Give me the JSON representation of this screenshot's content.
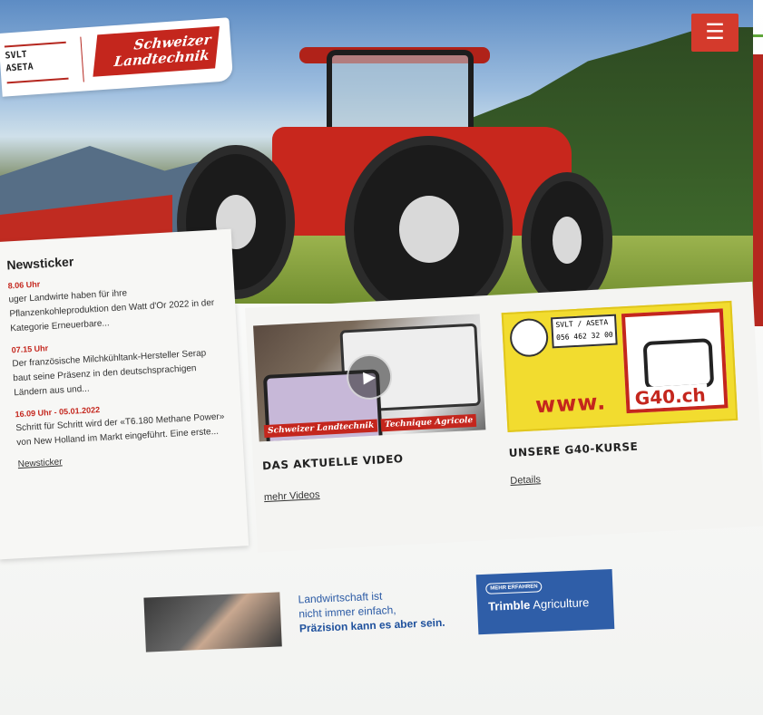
{
  "header": {
    "logo_svlt_line1": "SVLT",
    "logo_svlt_line2": "ASETA",
    "logo_brand_line1": "Schweizer",
    "logo_brand_line2": "Landtechnik",
    "menu_icon": "hamburger-menu-icon",
    "menu_glyph": "☰"
  },
  "newsticker": {
    "title": "Newsticker",
    "items": [
      {
        "time": "8.06 Uhr",
        "text": "uger Landwirte haben für ihre Pflanzenkohleproduktion den Watt d'Or 2022 in der Kategorie Erneuerbare..."
      },
      {
        "time": "07.15 Uhr",
        "text": "Der französische Milchkühltank-Hersteller Serap baut seine Präsenz in den deutschsprachigen Ländern aus und..."
      },
      {
        "time": "16.09 Uhr - 05.01.2022",
        "text": "Schritt für Schritt wird der «T6.180 Methane Power» von New Holland im Markt eingeführt. Eine erste..."
      }
    ],
    "more_link": "Newsticker"
  },
  "video_card": {
    "title": "DAS AKTUELLE VIDEO",
    "link": "mehr Videos",
    "play_glyph": "▶",
    "watermark_left": "Schweizer Landtechnik",
    "watermark_right": "Technique Agricole"
  },
  "g40_card": {
    "title": "UNSERE G40-KURSE",
    "link": "Details",
    "banner_info_line1": "SVLT / ASETA",
    "banner_info_line2": "056 462 32 00",
    "banner_www": "www.",
    "banner_domain": "G40.ch"
  },
  "ad": {
    "line1": "Landwirtschaft ist",
    "line2": "nicht immer einfach,",
    "line3": "Präzision kann es aber sein.",
    "badge": "MEHR ERFAHREN",
    "brand": "Trimble",
    "brand_suffix": "Agriculture"
  },
  "colors": {
    "brand_red": "#c4261d",
    "accent_yellow": "#f2dc2f",
    "trimble_blue": "#2f5ea8"
  }
}
